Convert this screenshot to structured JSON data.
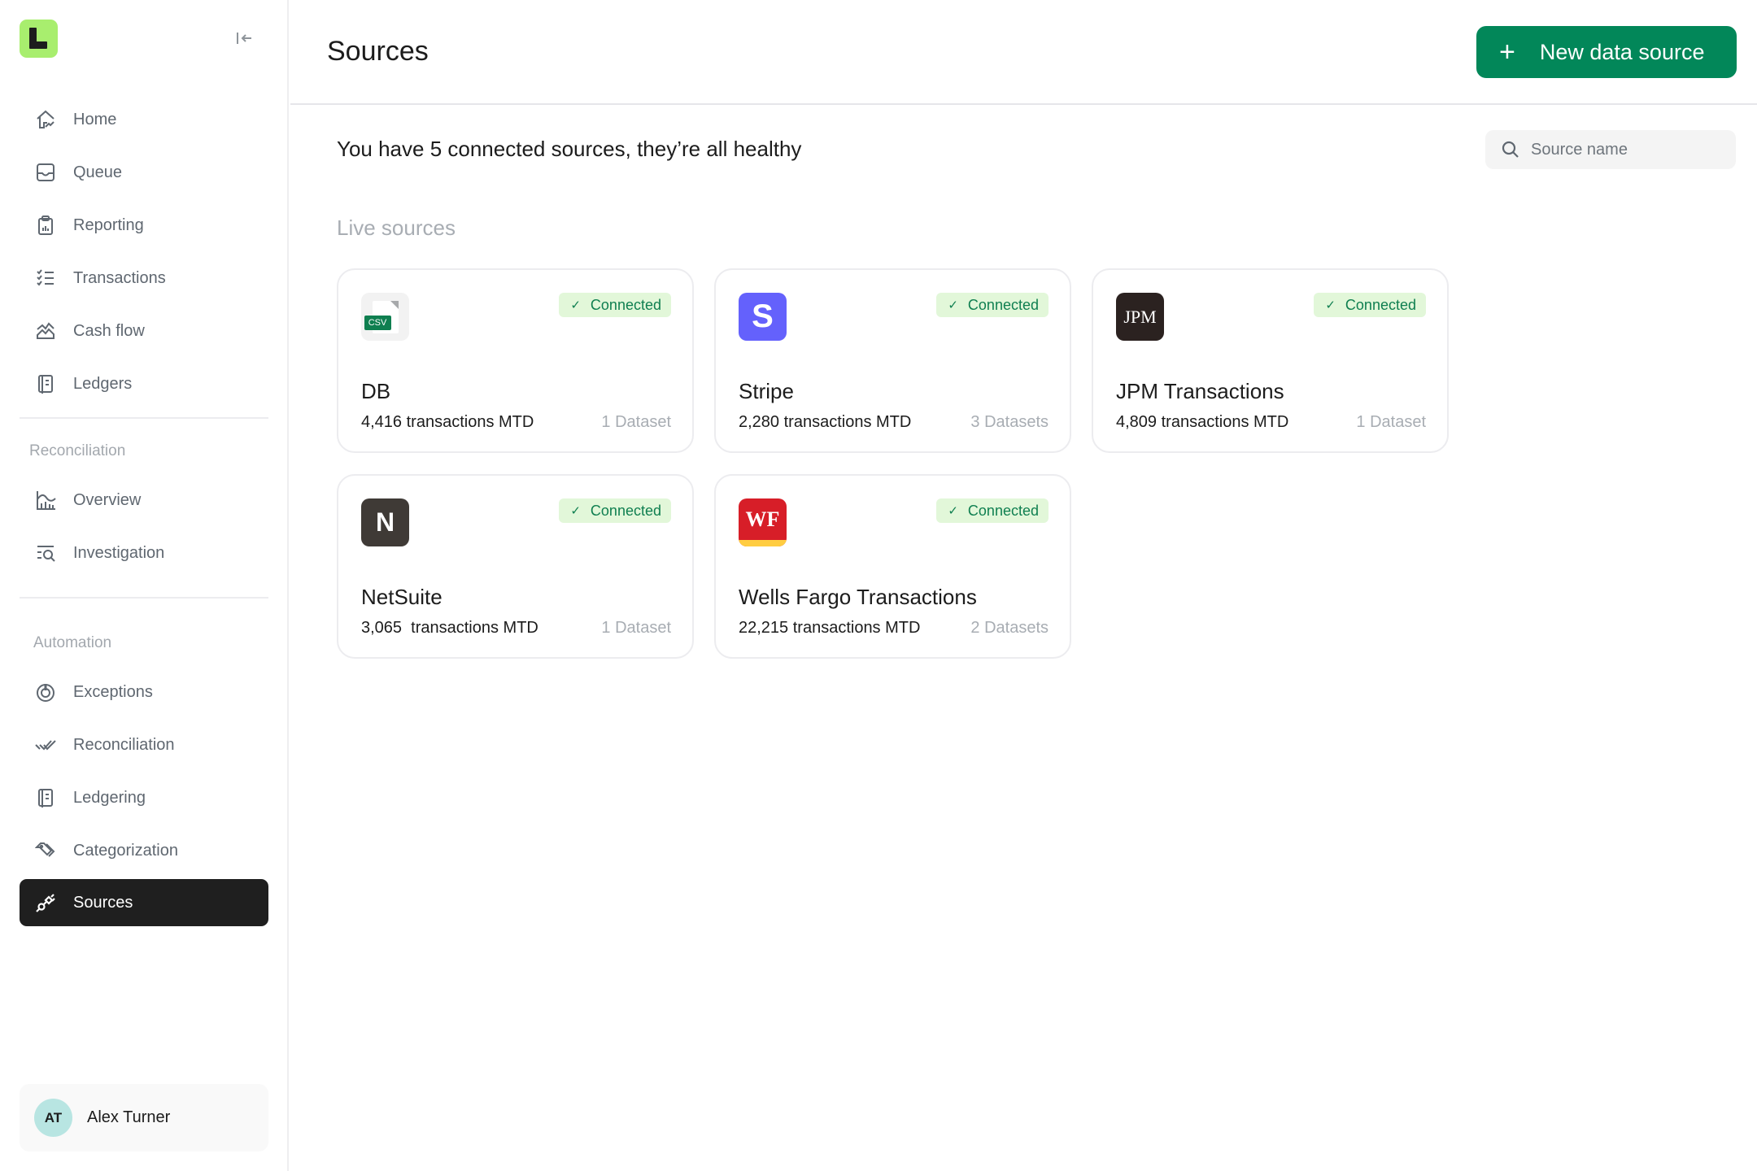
{
  "app": {
    "brand_color": "#a8ee6e",
    "accent_color": "#028759"
  },
  "sidebar": {
    "collapse_icon": "collapse-left-icon",
    "primary_items": [
      {
        "label": "Home",
        "icon": "home-icon"
      },
      {
        "label": "Queue",
        "icon": "inbox-icon"
      },
      {
        "label": "Reporting",
        "icon": "clipboard-chart-icon"
      },
      {
        "label": "Transactions",
        "icon": "checklist-icon"
      },
      {
        "label": "Cash flow",
        "icon": "area-chart-icon"
      },
      {
        "label": "Ledgers",
        "icon": "ledger-book-icon"
      }
    ],
    "reconciliation_section": {
      "title": "Reconciliation",
      "items": [
        {
          "label": "Overview",
          "icon": "bar-chart-icon"
        },
        {
          "label": "Investigation",
          "icon": "search-list-icon"
        }
      ]
    },
    "automation_section": {
      "title": "Automation",
      "items": [
        {
          "label": "Exceptions",
          "icon": "target-alert-icon"
        },
        {
          "label": "Reconciliation",
          "icon": "double-check-icon"
        },
        {
          "label": "Ledgering",
          "icon": "ledger-book-icon"
        },
        {
          "label": "Categorization",
          "icon": "tags-icon"
        },
        {
          "label": "Sources",
          "icon": "plug-icon",
          "active": true
        }
      ]
    },
    "user": {
      "initials": "AT",
      "name": "Alex Turner"
    }
  },
  "header": {
    "title": "Sources",
    "new_button_label": "New data source"
  },
  "main": {
    "summary": "You have 5 connected sources, they’re all healthy",
    "search_placeholder": "Source name",
    "section_title": "Live sources",
    "sources": [
      {
        "name": "DB",
        "logo": "csv",
        "status": "Connected",
        "transactions": "4,416 transactions MTD",
        "datasets": "1 Dataset"
      },
      {
        "name": "Stripe",
        "logo": "S",
        "status": "Connected",
        "transactions": "2,280 transactions MTD",
        "datasets": "3 Datasets"
      },
      {
        "name": "JPM Transactions",
        "logo": "JPM",
        "status": "Connected",
        "transactions": "4,809 transactions MTD",
        "datasets": "1 Dataset"
      },
      {
        "name": "NetSuite",
        "logo": "N",
        "status": "Connected",
        "transactions": "3,065  transactions MTD",
        "datasets": "1 Dataset"
      },
      {
        "name": "Wells Fargo Transactions",
        "logo": "WF",
        "status": "Connected",
        "transactions": "22,215 transactions MTD",
        "datasets": "2 Datasets"
      }
    ],
    "csv_tag": "CSV",
    "status_color": "#0f7f50"
  }
}
